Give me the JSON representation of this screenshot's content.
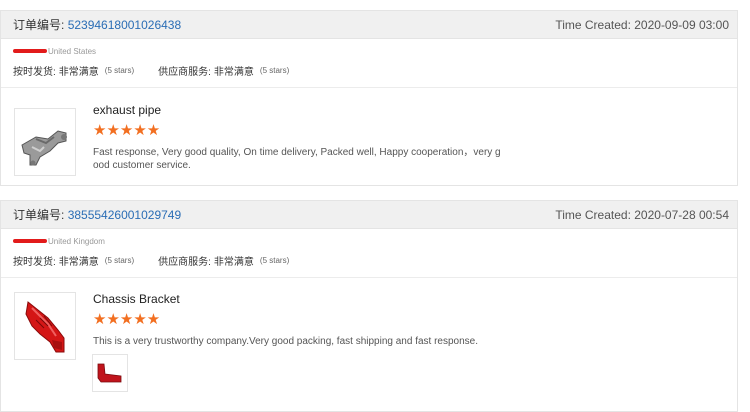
{
  "orders": [
    {
      "order_label": "订单编号:",
      "order_number": "52394618001026438",
      "time_created": "Time Created: 2020-09-09 03:00",
      "country": "United States",
      "ratings": [
        {
          "label": "按时发货:",
          "value": "非常满意",
          "stars": "(5 stars)"
        },
        {
          "label": "供应商服务:",
          "value": "非常满意",
          "stars": "(5 stars)"
        }
      ],
      "product_name": "exhaust pipe",
      "star_rating": 5,
      "stars_glyphs": "★★★★★",
      "review_text": "Fast response, Very good quality, On time delivery, Packed well, Happy cooperation，very good customer service.",
      "thumbnail_icon": "exhaust-pipe-image"
    },
    {
      "order_label": "订单编号:",
      "order_number": "38555426001029749",
      "time_created": "Time Created: 2020-07-28 00:54",
      "country": "United Kingdom",
      "ratings": [
        {
          "label": "按时发货:",
          "value": "非常满意",
          "stars": "(5 stars)"
        },
        {
          "label": "供应商服务:",
          "value": "非常满意",
          "stars": "(5 stars)"
        }
      ],
      "product_name": "Chassis Bracket",
      "star_rating": 5,
      "stars_glyphs": "★★★★★",
      "review_text": "This is a very trustworthy company.Very good packing, fast shipping and fast response.",
      "thumbnail_icon": "chassis-bracket-image",
      "photo_icon": "review-photo-bracket"
    }
  ],
  "colors": {
    "link": "#2a6db5",
    "star": "#f26f21",
    "header_bg": "#f0f0f0",
    "redaction": "#e21b1b",
    "bracket_red": "#d41616"
  }
}
